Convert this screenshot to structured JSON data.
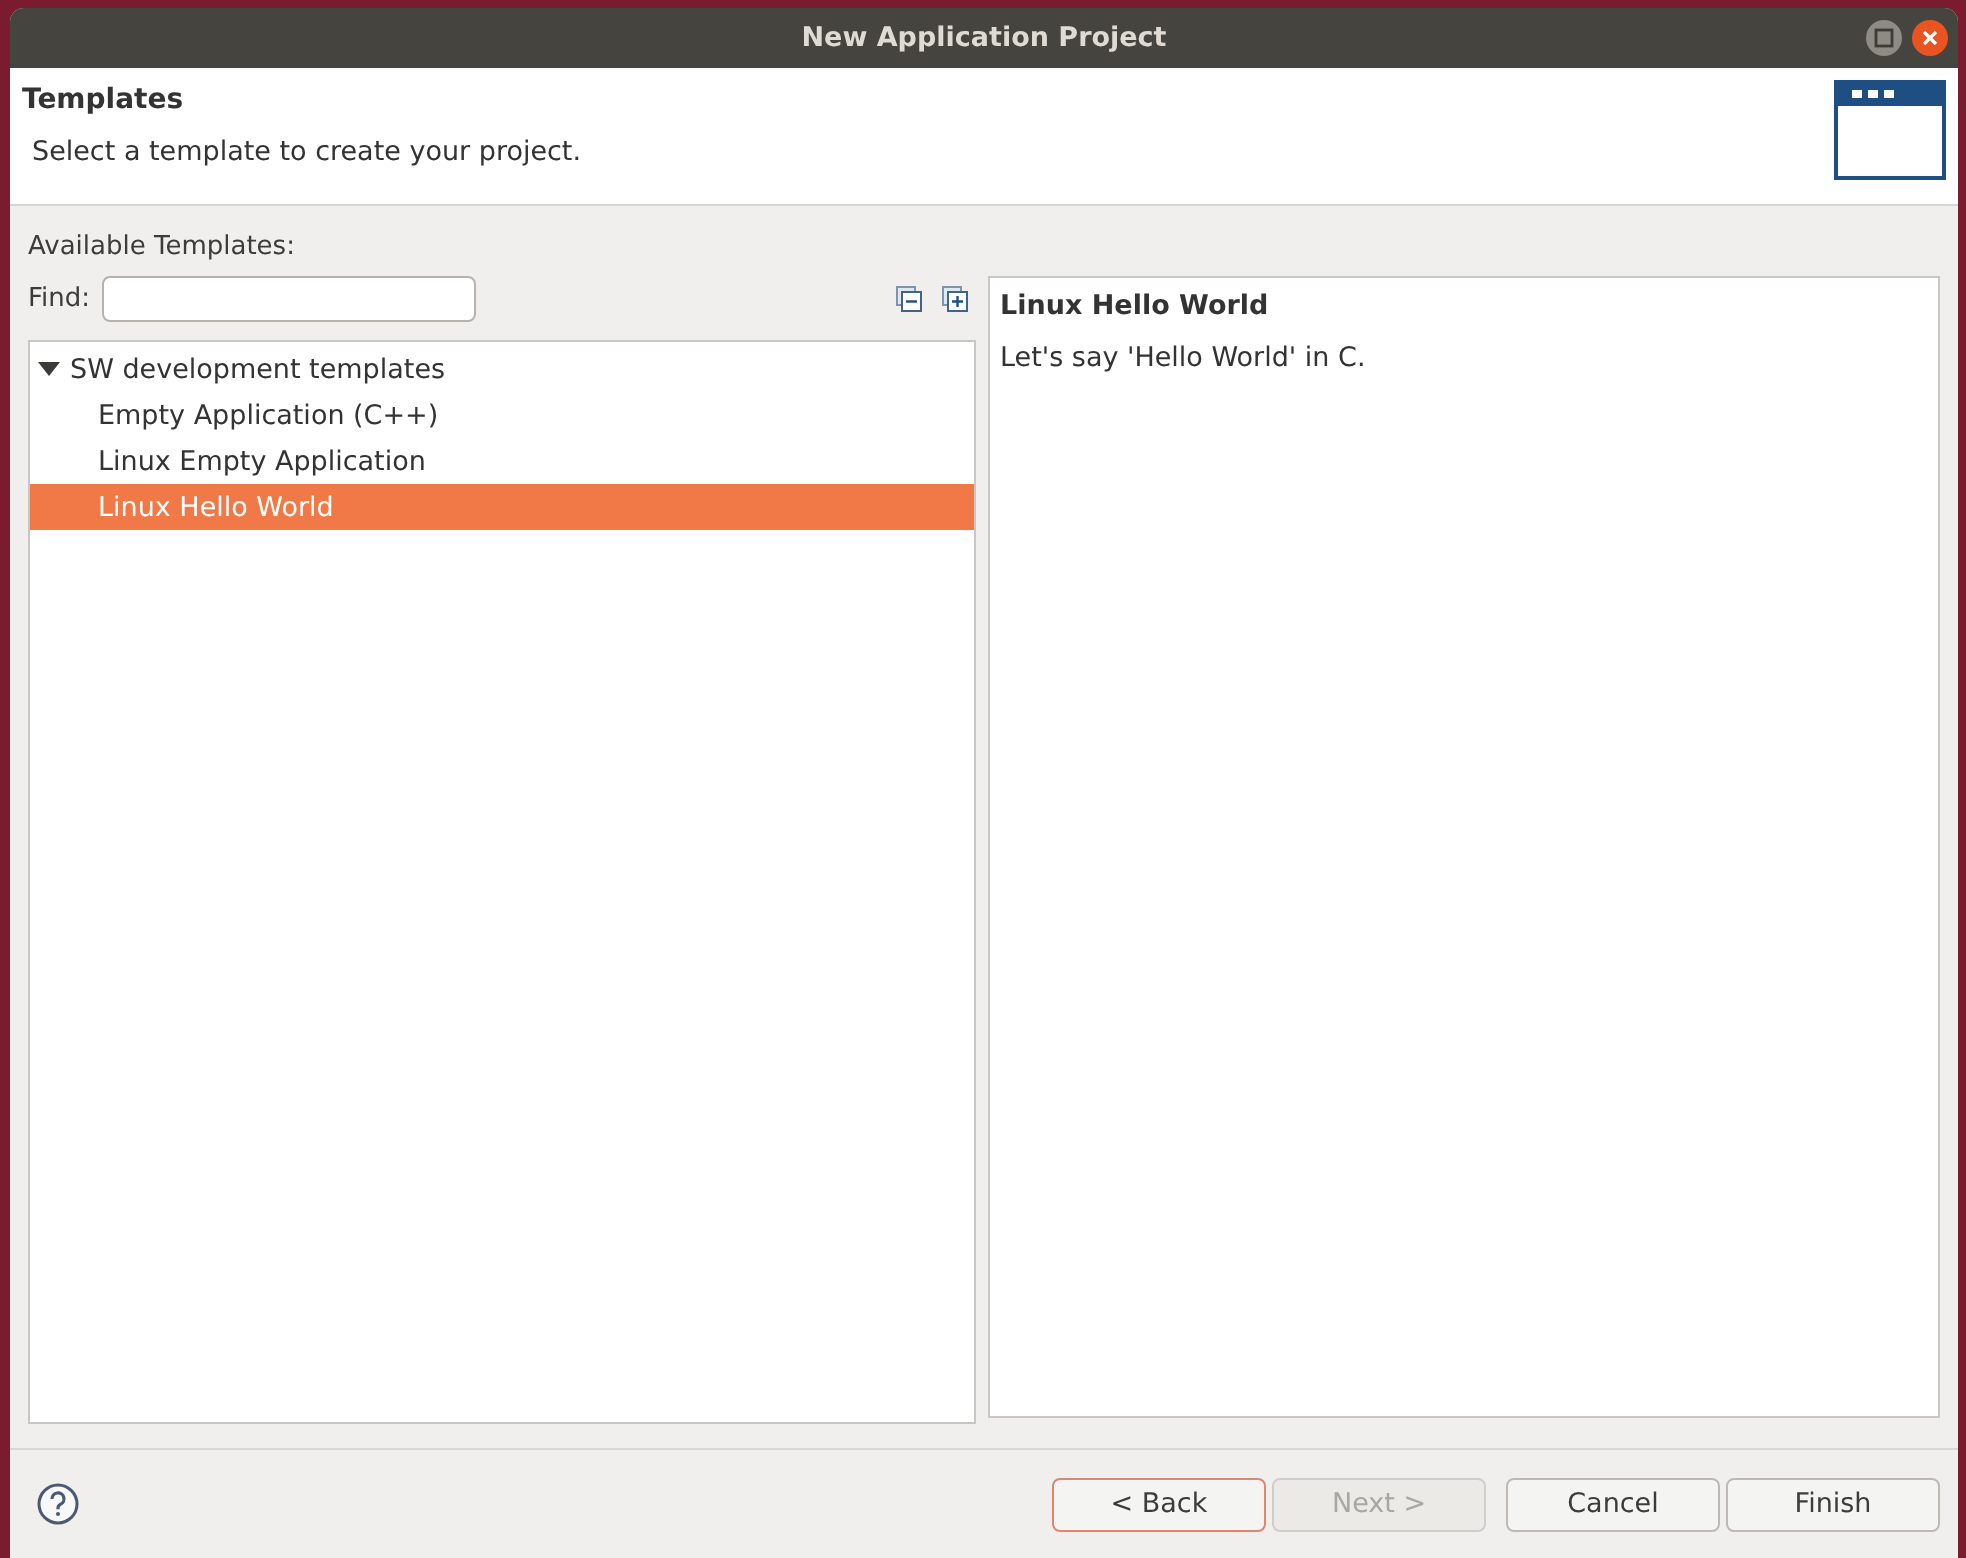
{
  "window": {
    "title": "New Application Project"
  },
  "header": {
    "title": "Templates",
    "description": "Select a template to create your project."
  },
  "available_label": "Available Templates:",
  "find": {
    "label": "Find:"
  },
  "tree": [
    {
      "label": "SW development templates",
      "expanded": true,
      "selected": false,
      "children": [
        {
          "label": "Empty Application (C++)",
          "selected": false
        },
        {
          "label": "Linux Empty Application",
          "selected": false
        },
        {
          "label": "Linux Hello World",
          "selected": true
        }
      ]
    }
  ],
  "details": {
    "title": "Linux Hello World",
    "text": "Let's say 'Hello World' in C."
  },
  "buttons": [
    {
      "label": "< Back",
      "disabled": false,
      "default": true
    },
    {
      "label": "Next >",
      "disabled": true,
      "default": false
    },
    {
      "label": "Cancel",
      "disabled": false,
      "default": false
    },
    {
      "label": "Finish",
      "disabled": false,
      "default": false
    }
  ]
}
